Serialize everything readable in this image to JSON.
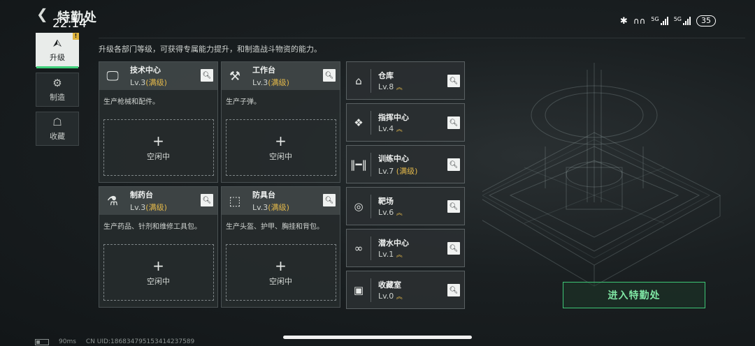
{
  "header": {
    "title": "特勤处",
    "back_icon": "chevron-left-icon"
  },
  "status_bar": {
    "time": "22:14",
    "network1": "5G",
    "network2": "5G",
    "battery": "35"
  },
  "nav": [
    {
      "label": "升级",
      "icon": "upgrade-icon",
      "active": true,
      "badge": "!"
    },
    {
      "label": "制造",
      "icon": "gear-icon",
      "active": false
    },
    {
      "label": "收藏",
      "icon": "trophy-icon",
      "active": false
    }
  ],
  "description": "升级各部门等级，可获得专属能力提升，和制造战斗物资的能力。",
  "stations": [
    {
      "name": "技术中心",
      "level": "Lv.3",
      "max": "(满级)",
      "desc": "生产枪械和配件。",
      "slot_plus": "+",
      "slot_text": "空闲中",
      "icon": "computer-icon"
    },
    {
      "name": "工作台",
      "level": "Lv.3",
      "max": "(满级)",
      "desc": "生产子弹。",
      "slot_plus": "+",
      "slot_text": "空闲中",
      "icon": "tools-icon"
    },
    {
      "name": "制药台",
      "level": "Lv.3",
      "max": "(满级)",
      "desc": "生产药品、针剂和维修工具包。",
      "slot_plus": "+",
      "slot_text": "空闲中",
      "icon": "microscope-icon"
    },
    {
      "name": "防具台",
      "level": "Lv.3",
      "max": "(满级)",
      "desc": "生产头盔、护甲、胸挂和背包。",
      "slot_plus": "+",
      "slot_text": "空闲中",
      "icon": "boxes-icon"
    }
  ],
  "facilities": [
    {
      "name": "仓库",
      "level": "Lv.8",
      "arrow": "︽",
      "max": "",
      "icon": "warehouse-icon"
    },
    {
      "name": "指挥中心",
      "level": "Lv.4",
      "arrow": "︽",
      "max": "",
      "icon": "chip-icon"
    },
    {
      "name": "训练中心",
      "level": "Lv.7",
      "arrow": "",
      "max": "(满级)",
      "icon": "dumbbell-icon"
    },
    {
      "name": "靶场",
      "level": "Lv.6",
      "arrow": "︽",
      "max": "",
      "icon": "target-icon"
    },
    {
      "name": "潜水中心",
      "level": "Lv.1",
      "arrow": "︽",
      "max": "",
      "icon": "diving-mask-icon"
    },
    {
      "name": "收藏室",
      "level": "Lv.0",
      "arrow": "︽",
      "max": "",
      "icon": "display-case-icon"
    }
  ],
  "enter_button": "进入特勤处",
  "bottom": {
    "ping": "90ms",
    "uid": "CN UID:186834795153414237589"
  },
  "colors": {
    "accent_green": "#3ec776",
    "gold": "#e3b84a"
  }
}
